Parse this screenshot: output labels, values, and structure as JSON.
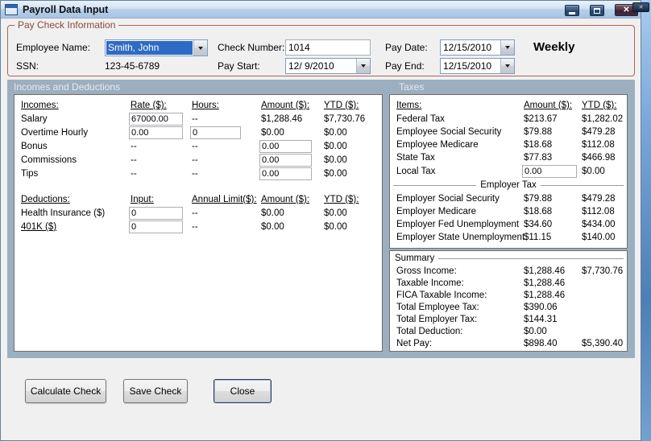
{
  "window": {
    "title": "Payroll Data Input"
  },
  "icons": {
    "close": "✕"
  },
  "paycheck": {
    "group_label": "Pay Check Information",
    "employee_name": {
      "label": "Employee Name:",
      "value": "Smith, John"
    },
    "ssn": {
      "label": "SSN:",
      "value": "123-45-6789"
    },
    "check_number": {
      "label": "Check Number:",
      "value": "1014"
    },
    "pay_start": {
      "label": "Pay Start:",
      "value": "12/ 9/2010"
    },
    "pay_date": {
      "label": "Pay Date:",
      "value": "12/15/2010"
    },
    "pay_end": {
      "label": "Pay End:",
      "value": "12/15/2010"
    },
    "frequency": "Weekly"
  },
  "sections": {
    "incomes_deductions": "Incomes and Deductions",
    "taxes": "Taxes"
  },
  "incomes": {
    "headers": {
      "name": "Incomes:",
      "rate": "Rate ($):",
      "hours": "Hours:",
      "amount": "Amount ($):",
      "ytd": "YTD ($):"
    },
    "rows": [
      {
        "name": "Salary",
        "rate": "67000.00",
        "hours": "--",
        "amount": "$1,288.46",
        "ytd": "$7,730.76"
      },
      {
        "name": "Overtime Hourly",
        "rate": "0.00",
        "hours": "0",
        "amount": "$0.00",
        "ytd": "$0.00"
      },
      {
        "name": "Bonus",
        "rate": "--",
        "hours": "--",
        "amount": "0.00",
        "ytd": "$0.00"
      },
      {
        "name": "Commissions",
        "rate": "--",
        "hours": "--",
        "amount": "0.00",
        "ytd": "$0.00"
      },
      {
        "name": "Tips",
        "rate": "--",
        "hours": "--",
        "amount": "0.00",
        "ytd": "$0.00"
      }
    ]
  },
  "deductions": {
    "headers": {
      "name": "Deductions:",
      "input": "Input:",
      "limit": "Annual Limit($):",
      "amount": "Amount ($):",
      "ytd": "YTD ($):"
    },
    "rows": [
      {
        "name": "Health Insurance ($)",
        "input": "0",
        "limit": "--",
        "amount": "$0.00",
        "ytd": "$0.00"
      },
      {
        "name": "401K ($)",
        "input": "0",
        "limit": "--",
        "amount": "$0.00",
        "ytd": "$0.00"
      }
    ]
  },
  "taxes": {
    "headers": {
      "name": "Items:",
      "amount": "Amount ($):",
      "ytd": "YTD ($):"
    },
    "employee_rows": [
      {
        "name": "Federal Tax",
        "amount": "$213.67",
        "ytd": "$1,282.02"
      },
      {
        "name": "Employee Social Security",
        "amount": "$79.88",
        "ytd": "$479.28"
      },
      {
        "name": "Employee Medicare",
        "amount": "$18.68",
        "ytd": "$112.08"
      },
      {
        "name": "State Tax",
        "amount": "$77.83",
        "ytd": "$466.98"
      },
      {
        "name": "Local Tax",
        "amount": "0.00",
        "ytd": "$0.00"
      }
    ],
    "divider": "Employer Tax",
    "employer_rows": [
      {
        "name": "Employer Social Security",
        "amount": "$79.88",
        "ytd": "$479.28"
      },
      {
        "name": "Employer Medicare",
        "amount": "$18.68",
        "ytd": "$112.08"
      },
      {
        "name": "Employer Fed Unemployment",
        "amount": "$34.60",
        "ytd": "$434.00"
      },
      {
        "name": "Employer State Unemployment",
        "amount": "$11.15",
        "ytd": "$140.00"
      }
    ]
  },
  "summary": {
    "title": "Summary",
    "rows": [
      {
        "name": "Gross Income:",
        "amount": "$1,288.46",
        "ytd": "$7,730.76"
      },
      {
        "name": "Taxable Income:",
        "amount": "$1,288.46",
        "ytd": ""
      },
      {
        "name": "FICA Taxable Income:",
        "amount": "$1,288.46",
        "ytd": ""
      },
      {
        "name": "Total Employee Tax:",
        "amount": "$390.06",
        "ytd": ""
      },
      {
        "name": "Total Employer Tax:",
        "amount": "$144.31",
        "ytd": ""
      },
      {
        "name": "Total Deduction:",
        "amount": "$0.00",
        "ytd": ""
      },
      {
        "name": "Net Pay:",
        "amount": "$898.40",
        "ytd": "$5,390.40"
      }
    ]
  },
  "buttons": {
    "calculate": "Calculate Check",
    "save": "Save Check",
    "close": "Close"
  },
  "colors": {
    "selection": "#2e6bc4",
    "groupbox_border": "#b4604e",
    "panel_background": "#9cafc1"
  }
}
